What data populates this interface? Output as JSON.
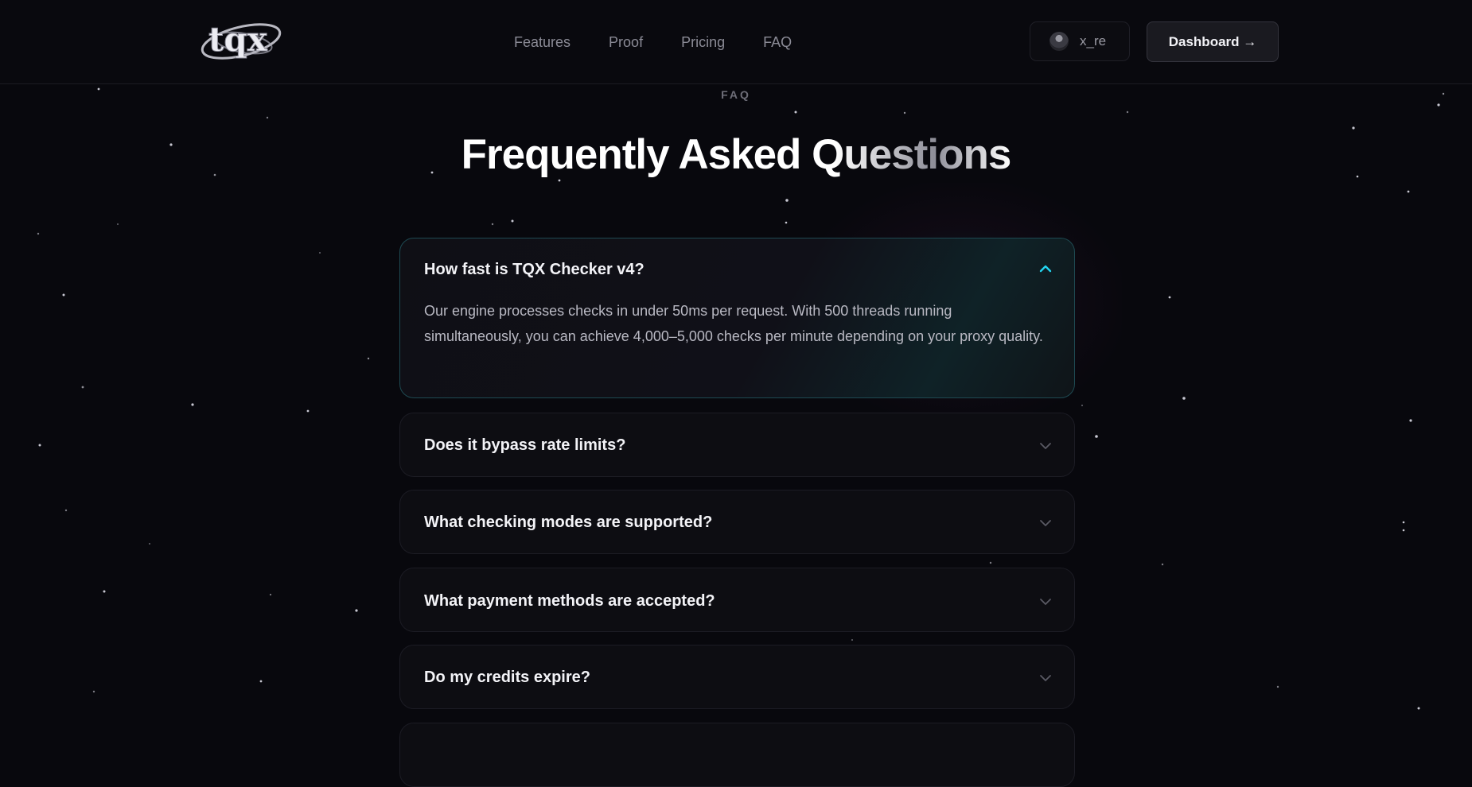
{
  "header": {
    "logo_text": "tqx",
    "nav": [
      "Features",
      "Proof",
      "Pricing",
      "FAQ"
    ],
    "user": {
      "name": "x_re"
    },
    "dashboard_label": "Dashboard →"
  },
  "section": {
    "eyebrow": "FAQ",
    "title": "Frequently Asked Questions"
  },
  "faq": [
    {
      "question": "How fast is TQX Checker v4?",
      "expanded": true,
      "answer": "Our engine processes checks in under 50ms per request. With 500 threads running simultaneously, you can achieve 4,000–5,000 checks per minute depending on your proxy quality."
    },
    {
      "question": "Does it bypass rate limits?",
      "expanded": false
    },
    {
      "question": "What checking modes are supported?",
      "expanded": false
    },
    {
      "question": "What payment methods are accepted?",
      "expanded": false
    },
    {
      "question": "Do my credits expire?",
      "expanded": false
    }
  ],
  "colors": {
    "background": "#08080d",
    "accent": "#22d3ee",
    "card": "#0d0d12",
    "open_card_border": "#1e4a52"
  },
  "icons": {
    "expanded": "chevron-up-icon",
    "collapsed": "chevron-down-icon",
    "avatar": "user-avatar"
  }
}
